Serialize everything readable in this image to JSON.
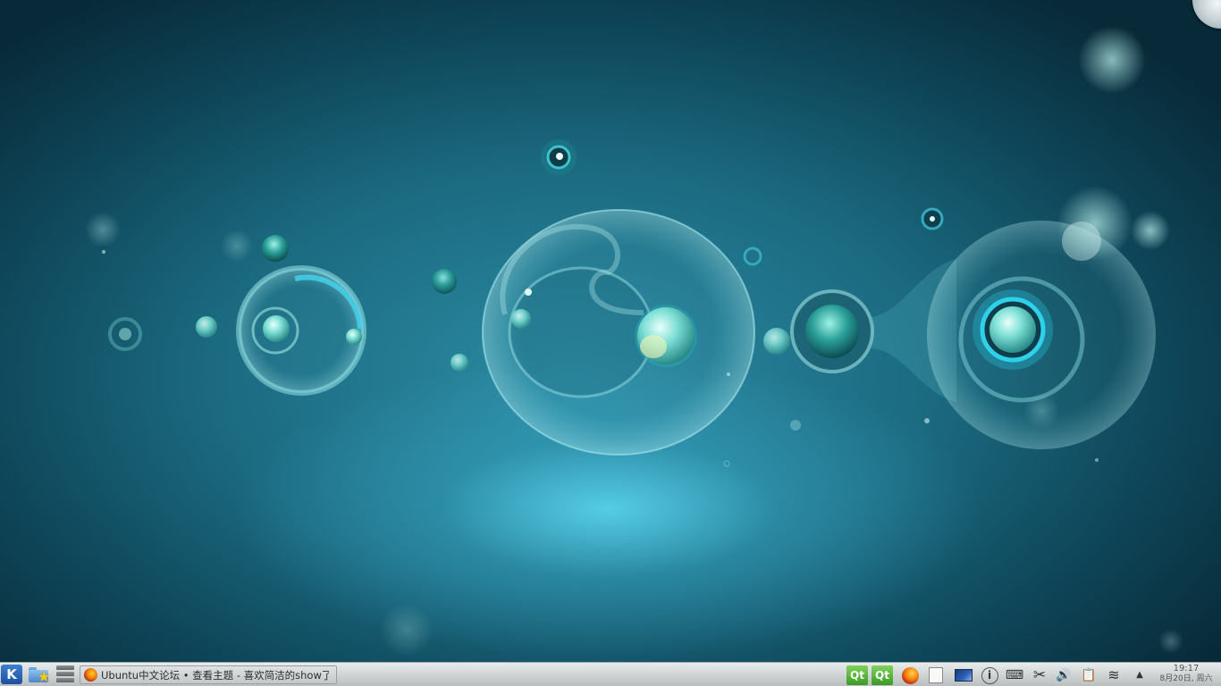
{
  "desktop": {
    "wallpaper": "kde-bubbles-teal",
    "corner_icon": "cashew-icon"
  },
  "panel": {
    "launcher_glyph": "K",
    "launcher_icon": "kde-kickoff-icon",
    "favorites_icon": "folder-star-icon",
    "desktop_switch_icon": "desktop-stack-icon"
  },
  "taskbar": {
    "tasks": [
      {
        "title": "Ubuntu中文论坛 • 查看主题 - 喜欢简洁的show了",
        "icon": "firefox-icon"
      }
    ]
  },
  "tray": {
    "qt1_label": "Qt",
    "qt1_icon": "qt-assistant-icon",
    "qt2_label": "Qt",
    "qt2_icon": "qt-designer-icon",
    "firefox_icon": "firefox-icon",
    "notes_icon": "notes-icon",
    "display_icon": "display-icon",
    "info_glyph": "i",
    "info_icon": "info-icon",
    "keyboard_glyph": "⌨",
    "scissors_glyph": "✂",
    "volume_glyph": "🔊",
    "clipboard_glyph": "📋",
    "wifi_glyph": "≋",
    "expand_glyph": "▲"
  },
  "clock": {
    "time": "19:17",
    "date": "8月20日, 周六"
  },
  "colors": {
    "panel_top": "#e9ecec",
    "panel_bottom": "#b9bebf",
    "wallpaper_glow": "#5fdcf5",
    "wallpaper_dark": "#082a38"
  }
}
